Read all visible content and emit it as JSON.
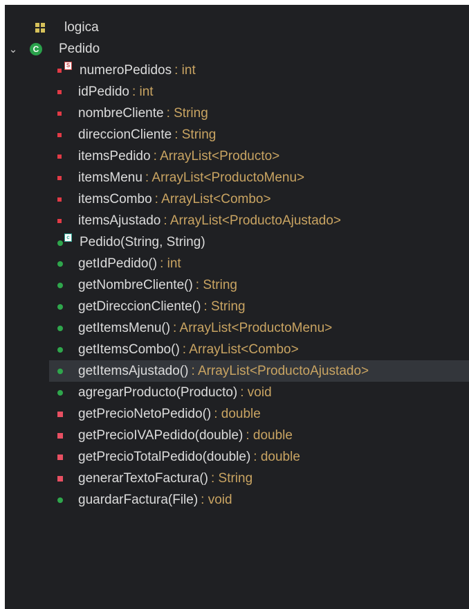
{
  "tree": {
    "package": {
      "label": "logica",
      "icon": "package-icon"
    },
    "class": {
      "label": "Pedido",
      "icon": "class-icon",
      "expanded": true
    },
    "items": [
      {
        "kind": "static-field",
        "name": "numeroPedidos",
        "type": ": int"
      },
      {
        "kind": "field",
        "name": "idPedido",
        "type": ": int"
      },
      {
        "kind": "field",
        "name": "nombreCliente",
        "type": ": String"
      },
      {
        "kind": "field",
        "name": "direccionCliente",
        "type": ": String"
      },
      {
        "kind": "field",
        "name": "itemsPedido",
        "type": ": ArrayList<Producto>"
      },
      {
        "kind": "field",
        "name": "itemsMenu",
        "type": ": ArrayList<ProductoMenu>"
      },
      {
        "kind": "field",
        "name": "itemsCombo",
        "type": ": ArrayList<Combo>"
      },
      {
        "kind": "field",
        "name": "itemsAjustado",
        "type": ": ArrayList<ProductoAjustado>"
      },
      {
        "kind": "constructor",
        "name": "Pedido(String, String)",
        "type": ""
      },
      {
        "kind": "public-method",
        "name": "getIdPedido()",
        "type": ": int"
      },
      {
        "kind": "public-method",
        "name": "getNombreCliente()",
        "type": ": String"
      },
      {
        "kind": "public-method",
        "name": "getDireccionCliente()",
        "type": ": String"
      },
      {
        "kind": "public-method",
        "name": "getItemsMenu()",
        "type": ": ArrayList<ProductoMenu>"
      },
      {
        "kind": "public-method",
        "name": "getItemsCombo()",
        "type": ": ArrayList<Combo>"
      },
      {
        "kind": "public-method",
        "name": "getItemsAjustado()",
        "type": ": ArrayList<ProductoAjustado>",
        "selected": true
      },
      {
        "kind": "public-method",
        "name": "agregarProducto(Producto)",
        "type": ": void"
      },
      {
        "kind": "private-method",
        "name": "getPrecioNetoPedido()",
        "type": ": double"
      },
      {
        "kind": "private-method",
        "name": "getPrecioIVAPedido(double)",
        "type": ": double"
      },
      {
        "kind": "private-method",
        "name": "getPrecioTotalPedido(double)",
        "type": ": double"
      },
      {
        "kind": "private-method",
        "name": "generarTextoFactura()",
        "type": ": String"
      },
      {
        "kind": "public-method",
        "name": "guardarFactura(File)",
        "type": ": void"
      }
    ],
    "badges": {
      "static": "S",
      "constructor": "c"
    },
    "colors": {
      "background": "#1f2023",
      "name": "#dcdcdc",
      "type": "#c9a462",
      "field": "#e23b46",
      "public": "#2fa64c",
      "private": "#e85062",
      "selected": "#33363b"
    }
  }
}
